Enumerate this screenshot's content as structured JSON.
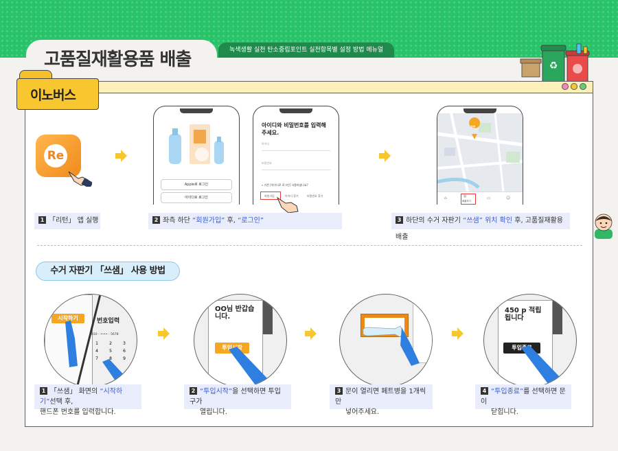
{
  "header": {
    "title": "고품질재활용품 배출",
    "subtitle": "녹색생활 실천 탄소중립포인트 실천항목별 설정 방법 메뉴얼"
  },
  "folder": {
    "label": "이노버스"
  },
  "app_icon": {
    "text": "Re"
  },
  "phone_login": {
    "apple_button": " Apple로 로그인",
    "id_login_button": "아이디로 로그인"
  },
  "phone_credentials": {
    "title": "아이디와 비밀번호를 입력해주세요.",
    "id_label": "아이디",
    "password_label": "비밀번호",
    "auto_login": "기존 [아이디로 로그인] 사용하셨나요?",
    "signup_link": "회원가입",
    "find_id_link": "아이디 찾기",
    "find_pw_link": "비밀번호 찾기"
  },
  "phone_map": {
    "marker_label": "자판",
    "bottom_tab_label": "배출하기"
  },
  "steps_top": [
    {
      "num": "1",
      "pre": "「리턴」 앱 실행",
      "hl": "",
      "post": "",
      "hl2": "",
      "post2": ""
    },
    {
      "num": "2",
      "pre": "좌측 하단 ",
      "hl": "“회원가입”",
      "post": " 후, ",
      "hl2": "“로그인”",
      "post2": ""
    },
    {
      "num": "3",
      "pre": "하단의 수거 자판기 ",
      "hl": "“쓰샘” 위치 확인",
      "post": " 후, 고품질재활용 배출",
      "hl2": "",
      "post2": ""
    }
  ],
  "section": {
    "title": "수거 자판기 「쓰샘」 사용 방법"
  },
  "kiosk": {
    "start_button": "시작하기",
    "phone_entry_title": "번호입력",
    "phone_number": "010 - •••• - 5678",
    "keypad": [
      "1",
      "2",
      "3",
      "4",
      "5",
      "6",
      "7",
      "8",
      "9"
    ],
    "return_text": "OO님 반갑습니다.",
    "insert_start_button": "투입시작",
    "points_text": "450 p 적립됩니다",
    "insert_end_button": "투입종료"
  },
  "steps_bottom": [
    {
      "num": "1",
      "line1_pre": "「쓰샘」 화면의 ",
      "line1_hl": "“시작하기”",
      "line1_post": "선택 후,",
      "line2": "핸드폰 번호를 입력합니다."
    },
    {
      "num": "2",
      "line1_pre": "",
      "line1_hl": "“투입시작”",
      "line1_post": "을 선택하면 투입구가",
      "line2": "열립니다."
    },
    {
      "num": "3",
      "line1_pre": "문이 열리면 페트병을 1개씩만",
      "line1_hl": "",
      "line1_post": "",
      "line2": "넣어주세요."
    },
    {
      "num": "4",
      "line1_pre": "",
      "line1_hl": "“투입종료”",
      "line1_post": "를 선택하면 문이",
      "line2": "닫힙니다."
    }
  ],
  "colors": {
    "band_green": "#29c46a",
    "accent_yellow": "#f8c62e",
    "caption_bg": "#e8ecfb",
    "highlight_blue": "#3b5ccc",
    "orange": "#f5a623"
  }
}
